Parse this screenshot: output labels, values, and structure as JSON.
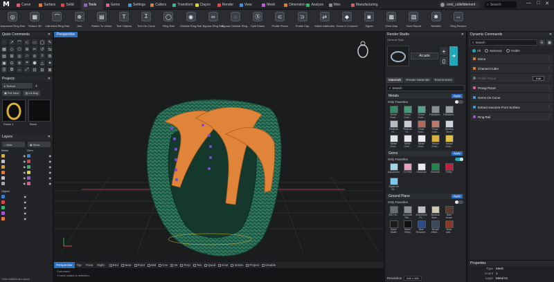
{
  "app": {
    "logo": "M"
  },
  "menu": [
    {
      "label": "Curve",
      "color": "#e05a7a"
    },
    {
      "label": "Surface",
      "color": "#e07a3a"
    },
    {
      "label": "Solid",
      "color": "#d94747"
    },
    {
      "label": "Tools",
      "color": "#9b59d0",
      "active": true
    },
    {
      "label": "Gems",
      "color": "#e05a9a"
    },
    {
      "label": "Settings",
      "color": "#3a9bd9"
    },
    {
      "label": "Cutters",
      "color": "#d97a3a"
    },
    {
      "label": "Transform",
      "color": "#3ab5a0"
    },
    {
      "label": "Clayoo",
      "color": "#d9d43a"
    },
    {
      "label": "Render",
      "color": "#d94747"
    },
    {
      "label": "View",
      "color": "#4a90e2"
    },
    {
      "label": "Mesh",
      "color": "#c05ad9"
    },
    {
      "label": "Dimension",
      "color": "#e07a3a"
    },
    {
      "label": "Analyze",
      "color": "#3ab56a"
    },
    {
      "label": "Misc",
      "color": "#8a8f96"
    },
    {
      "label": "Manufacturing",
      "color": "#e05a5a"
    }
  ],
  "user": {
    "name": "oriol_collelldemont"
  },
  "top_search": {
    "placeholder": "Search"
  },
  "window_controls": [
    "—",
    "□",
    "✕"
  ],
  "toolbar": [
    {
      "label": "Advanced Ring Rail",
      "icon": "ring-icon",
      "glyph": "◎"
    },
    {
      "label": "Texture 3D",
      "icon": "texture-icon",
      "glyph": "▦"
    },
    {
      "label": "Cathedral Ring Rail",
      "icon": "cathedral-icon",
      "glyph": "⌒"
    },
    {
      "label": "Join",
      "icon": "join-icon",
      "glyph": "⊕"
    },
    {
      "label": "Raster To Vector",
      "icon": "raster-icon",
      "glyph": "▤"
    },
    {
      "label": "Text Objects",
      "icon": "text-icon",
      "glyph": "T"
    },
    {
      "label": "Text On Curve",
      "icon": "text-curve-icon",
      "glyph": "Ꮖ"
    },
    {
      "label": "Ring Rail",
      "icon": "ring-rail-icon",
      "glyph": "◯"
    },
    {
      "label": "Outside Ring Rail",
      "icon": "outside-ring-icon",
      "glyph": "◉"
    },
    {
      "label": "Bypass Ring Rail",
      "icon": "bypass-ring-icon",
      "glyph": "∞"
    },
    {
      "label": "Bypass Outside Ring...",
      "icon": "bypass-outside-icon",
      "glyph": "◌"
    },
    {
      "label": "Split Shank",
      "icon": "split-shank-icon",
      "glyph": "Ⓢ"
    },
    {
      "label": "Profile Placer",
      "icon": "profile-placer-icon",
      "glyph": "⊂"
    },
    {
      "label": "Profile Cap",
      "icon": "profile-cap-icon",
      "glyph": "⊃"
    },
    {
      "label": "Match Attributes",
      "icon": "match-icon",
      "glyph": "⇄"
    },
    {
      "label": "Gems In Channel",
      "icon": "gems-channel-icon",
      "glyph": "◆"
    },
    {
      "label": "Signet",
      "icon": "signet-icon",
      "glyph": "◙"
    },
    {
      "label": "Gem Map",
      "icon": "gem-map-icon",
      "glyph": "▩"
    },
    {
      "label": "Tech Report",
      "icon": "report-icon",
      "glyph": "▥"
    },
    {
      "label": "Nebulizi",
      "icon": "nebulizi-icon",
      "glyph": "✱"
    },
    {
      "label": "Ring Resizer",
      "icon": "resizer-icon",
      "glyph": "⇔"
    }
  ],
  "left": {
    "quick_commands_title": "Quick Commands",
    "qc_glyphs": [
      "·",
      "↗",
      "⌒",
      "⊂",
      "▭",
      "◯",
      "✎",
      "▦",
      "◇",
      "⬡",
      "⊕",
      "✂",
      "↺",
      "⇆",
      "▤",
      "⊞",
      "◎",
      "⌂",
      "⊘",
      "≡",
      "⚙",
      "▣",
      "⊙",
      "⊚",
      "⌗",
      "⬢",
      "△",
      "✦",
      "☰",
      "⧉",
      "↔",
      "⤢",
      "⊡",
      "⊟",
      "⊠"
    ],
    "projects_title": "Projects",
    "project_select": "Texture",
    "full_save": "Full Save",
    "ink_bag": "Ink Bag",
    "thumbs": [
      "Dallas 1",
      "Blank"
    ],
    "layers_title": "Layers",
    "hide": "Hide",
    "show": "Show",
    "layer_cols": [
      {
        "header": "Metal",
        "rows": [
          {
            "c": "#d9b23a"
          },
          {
            "c": "#c0c4ca"
          },
          {
            "c": "#d4a24a"
          },
          {
            "c": "#e07a3a"
          },
          {
            "c": "#bfc3c9"
          },
          {
            "c": "#a8a8a8"
          }
        ]
      },
      {
        "header": "Gem",
        "rows": [
          {
            "c": "#3a7fd9"
          },
          {
            "c": "#d94747"
          },
          {
            "c": "#3ab56a"
          },
          {
            "c": "#d9d43a"
          },
          {
            "c": "#9b59d0"
          },
          {
            "c": "#e05a9a"
          }
        ]
      }
    ],
    "object_label": "Object",
    "object_rows": [
      {
        "c": "#3a7fd9"
      },
      {
        "c": "#d94747"
      },
      {
        "c": "#3ab56a"
      },
      {
        "c": "#9b59d0"
      },
      {
        "c": "#e07a3a"
      }
    ],
    "hide_layers": "Hide Additional Layers"
  },
  "viewport": {
    "title": "Perspective",
    "views": [
      "Perspective",
      "Top",
      "Front",
      "Right"
    ],
    "osnaps": [
      "End",
      "Near",
      "Point",
      "Mid",
      "Cen",
      "Int",
      "Perp",
      "Tan",
      "Quad",
      "Knot",
      "Vertex",
      "Project",
      "Disable"
    ],
    "cmdline": [
      "Command:",
      "1 mesh added to selection."
    ]
  },
  "render_studio": {
    "title": "Render Studio",
    "general_style": "General Style",
    "style_select": "Arcade",
    "tabs": [
      "Materials",
      "Render Materials",
      "Environment"
    ],
    "search_placeholder": "Search",
    "sections": [
      {
        "title": "Metals",
        "apply": "Apply",
        "only_favorites": "Only Favorites",
        "fav_on": false,
        "swatches": [
          {
            "t": "Green Gold...",
            "c": "#3a8a6a"
          },
          {
            "t": "Green Gold...",
            "c": "#4a9a7a"
          },
          {
            "t": "Green Gold...",
            "c": "#5aa08a"
          },
          {
            "t": "Palladium...",
            "c": "#8a8f96"
          },
          {
            "t": "Palladium...",
            "c": "#9aa0a6"
          },
          {
            "t": "Platinum Hi...",
            "c": "#b8bcc2"
          },
          {
            "t": "Platinum Hi...",
            "c": "#c8ccd2"
          },
          {
            "t": "Rose Gold...",
            "c": "#b06a5a"
          },
          {
            "t": "Rose Gold...",
            "c": "#c07a6a"
          },
          {
            "t": "Sterling Silver",
            "c": "#d0d4da"
          },
          {
            "t": "White Gold...",
            "c": "#dfe2e6"
          },
          {
            "t": "White Gold...",
            "c": "#e6e8eb"
          },
          {
            "t": "White Gold...",
            "c": "#eceef0"
          },
          {
            "t": "Yellow Gold...",
            "c": "#d9b23a"
          },
          {
            "t": "Yellow Gold...",
            "c": "#e0bf4a"
          }
        ]
      },
      {
        "title": "Gems",
        "apply": "Apply",
        "only_favorites": "Only Favorites",
        "fav_on": true,
        "swatches": [
          {
            "t": "Aquamarine",
            "c": "#9fd6e8"
          },
          {
            "t": "CZ Pink",
            "c": "#e8a0b8"
          },
          {
            "t": "Diamond",
            "c": "#e6e8eb"
          },
          {
            "t": "Emerald",
            "c": "#1e8a4a"
          },
          {
            "t": "Ruby",
            "c": "#c0203a"
          },
          {
            "t": "Topaz Ice Bl...",
            "c": "#7fc6e8"
          }
        ]
      },
      {
        "title": "Ground Plane",
        "apply": "Apply",
        "only_favorites": "Only Favorites",
        "fav_on": false,
        "swatches": [
          {
            "t": "300 Ho...",
            "c": "#6a6e74"
          },
          {
            "t": "Acoustic Tile...",
            "c": "#8a8f96"
          },
          {
            "t": "Aluminium Pl...",
            "c": "#bfc3c9"
          },
          {
            "t": "Banana Blue...",
            "c": "#d0c8b0"
          },
          {
            "t": "Bark brown",
            "c": "#5a3a2a"
          },
          {
            "t": "Black Matte",
            "c": "#1a1a1a"
          },
          {
            "t": "Black Shiny",
            "c": "#101010"
          },
          {
            "t": "Blue Textured...",
            "c": "#2a4a8a"
          },
          {
            "t": "Bluryff effect...",
            "c": "#3a4a5a"
          },
          {
            "t": "Brick wall...",
            "c": "#8a3a2a"
          }
        ]
      }
    ],
    "resolution_label": "Resolution",
    "resolution_value": "640 x 480"
  },
  "dynamic_commands": {
    "title": "Dynamic Commands",
    "search_placeholder": "Search",
    "radios": [
      "All",
      "Selected",
      "Visible"
    ],
    "items": [
      {
        "label": "Mirror",
        "c": "#e07a3a",
        "dim": false
      },
      {
        "label": "Channel Cutter",
        "c": "#e07a3a",
        "dim": false
      },
      {
        "label": "Profile Placer",
        "c": "#6f747b",
        "dim": true,
        "edit": "Edit"
      },
      {
        "label": "Prong Placer",
        "c": "#e05a9a",
        "dim": false
      },
      {
        "label": "Gems On Curve",
        "c": "#3a9bd9",
        "dim": false
      },
      {
        "label": "Extract Isocurve From Surface",
        "c": "#3a9bd9",
        "dim": false
      },
      {
        "label": "Ring Rail",
        "c": "#9b59d0",
        "dim": false
      }
    ]
  },
  "properties": {
    "title": "Properties",
    "rows": [
      {
        "k": "Type",
        "v": "Mesh"
      },
      {
        "k": "Count",
        "v": "1"
      },
      {
        "k": "Layer",
        "v": "Metal 01"
      }
    ]
  }
}
